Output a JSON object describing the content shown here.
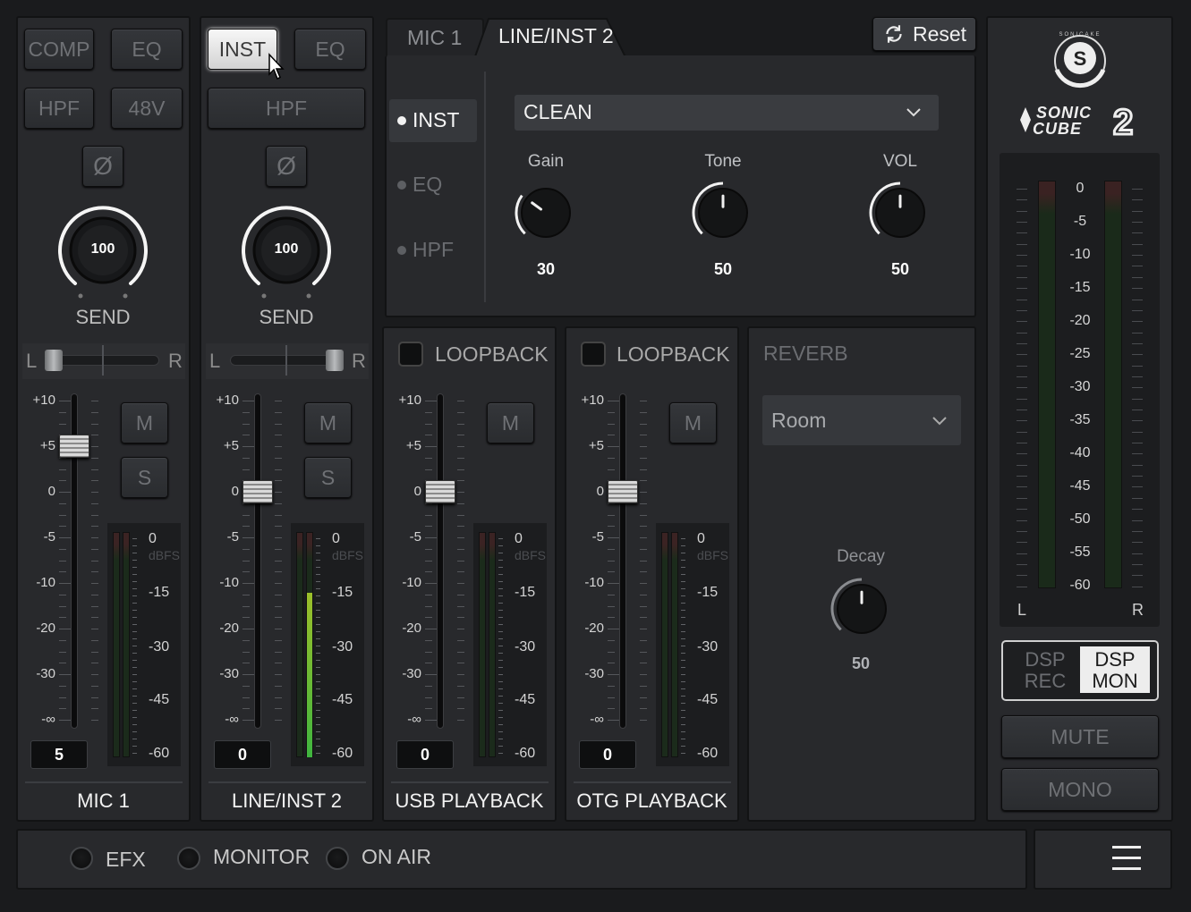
{
  "channels": [
    {
      "title": "MIC 1",
      "btn1": "COMP",
      "btn2": "EQ",
      "btn3": "HPF",
      "btn4": "48V",
      "phase": "Ø",
      "send_value": "100",
      "send_label": "SEND",
      "pan_l": "L",
      "pan_r": "R",
      "mute": "M",
      "solo": "S",
      "fader_value": "5"
    },
    {
      "title": "LINE/INST 2",
      "btn1": "INST",
      "btn2": "EQ",
      "btn3": "HPF",
      "phase": "Ø",
      "send_value": "100",
      "send_label": "SEND",
      "pan_l": "L",
      "pan_r": "R",
      "mute": "M",
      "solo": "S",
      "fader_value": "0"
    },
    {
      "title": "USB PLAYBACK",
      "loopback": "LOOPBACK",
      "mute": "M",
      "fader_value": "0"
    },
    {
      "title": "OTG PLAYBACK",
      "loopback": "LOOPBACK",
      "mute": "M",
      "fader_value": "0"
    }
  ],
  "fader_scale": [
    "+10",
    "+5",
    "0",
    "-5",
    "-10",
    "-20",
    "-30",
    "-∞"
  ],
  "meter_scale": [
    "0",
    "-15",
    "-30",
    "-45",
    "-60"
  ],
  "meter_unit": "dBFS",
  "inst_panel": {
    "tabs": [
      "MIC 1",
      "LINE/INST 2"
    ],
    "reset": "Reset",
    "sections": [
      "INST",
      "EQ",
      "HPF"
    ],
    "preset": "CLEAN",
    "knobs": [
      {
        "label": "Gain",
        "value": "30"
      },
      {
        "label": "Tone",
        "value": "50"
      },
      {
        "label": "VOL",
        "value": "50"
      }
    ]
  },
  "reverb": {
    "title": "REVERB",
    "type": "Room",
    "decay_label": "Decay",
    "decay_value": "50"
  },
  "master": {
    "brand_small": "SONICAKE",
    "brand": "SONIC CUBE 2",
    "meter_scale": [
      "0",
      "-5",
      "-10",
      "-15",
      "-20",
      "-25",
      "-30",
      "-35",
      "-40",
      "-45",
      "-50",
      "-55",
      "-60"
    ],
    "left": "L",
    "right": "R",
    "dsp_rec": "DSP REC",
    "dsp_mon": "DSP MON",
    "mute": "MUTE",
    "mono": "MONO"
  },
  "bottom": {
    "efx": "EFX",
    "monitor": "MONITOR",
    "on_air": "ON AIR"
  },
  "levels": {
    "ch1_fader_db": 5,
    "ch2_fader_db": 0,
    "ch3_fader_db": 0,
    "ch4_fader_db": 0,
    "ch2_meter_db": -15,
    "gain": 30,
    "tone": 50,
    "vol": 50,
    "decay": 50
  }
}
